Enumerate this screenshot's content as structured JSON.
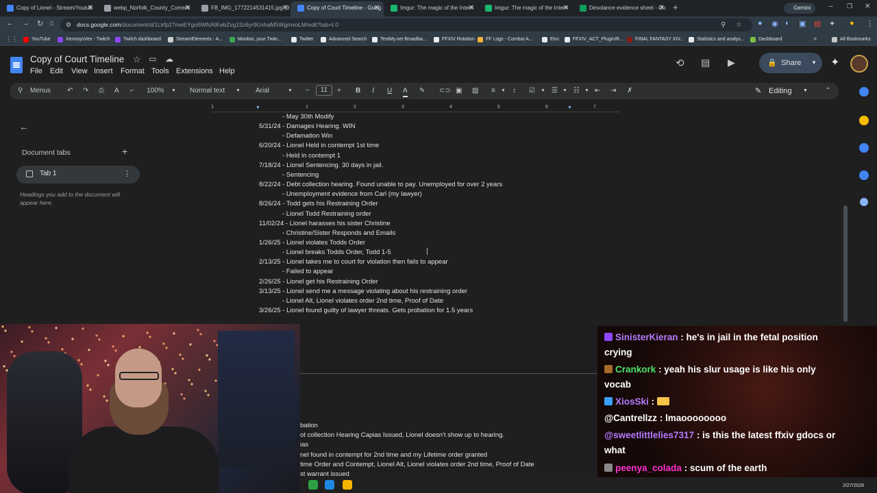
{
  "browser": {
    "tabs": [
      {
        "title": "Copy of Lionel - Stream/Youtub",
        "icon_color": "#4285f4"
      },
      {
        "title": "webp_Norfolk_County_Correcti",
        "icon_color": "#9aa0a6"
      },
      {
        "title": "FB_IMG_1772214531415.jpg (9",
        "icon_color": "#9aa0a6"
      },
      {
        "title": "Copy of Court Timeline - Goog",
        "icon_color": "#4285f4"
      },
      {
        "title": "Imgur: The magic of the Intern",
        "icon_color": "#1bb76e"
      },
      {
        "title": "Imgur: The magic of the Intern",
        "icon_color": "#1bb76e"
      },
      {
        "title": "Desolance evidence sheet - Go",
        "icon_color": "#0f9d58"
      }
    ],
    "new_tab_label": "+",
    "gemini_label": "Gemini",
    "url_host": "docs.google.com",
    "url_path": "/document/d/1Lkfp27meEYgo5WNAtKebZvg15z6yr9UxhaM5WgmvoLM/edit?tab=t.0",
    "bookmarks": [
      {
        "label": "YouTube",
        "icon_color": "#ff0000"
      },
      {
        "label": "XenosysVex - Twitch",
        "icon_color": "#9146ff"
      },
      {
        "label": "Twitch dashboard",
        "icon_color": "#9146ff"
      },
      {
        "label": "StreamElements - A...",
        "icon_color": "#cccccc"
      },
      {
        "label": "Moobot, your Twitc...",
        "icon_color": "#3aa757"
      },
      {
        "label": "Twitter",
        "icon_color": "#e8eaed"
      },
      {
        "label": "Advanced Search",
        "icon_color": "#e8eaed"
      },
      {
        "label": "TestMy.net Broadba...",
        "icon_color": "#e8eaed"
      },
      {
        "label": "FFXIV Rotation",
        "icon_color": "#e8eaed"
      },
      {
        "label": "FF Logs - Combat A...",
        "icon_color": "#f3b23a"
      },
      {
        "label": "Etro",
        "icon_color": "#e8eaed"
      },
      {
        "label": "FFXIV_ACT_Plugin/R...",
        "icon_color": "#e8eaed"
      },
      {
        "label": "FINAL FANTASY XIV...",
        "icon_color": "#8b1a1a"
      },
      {
        "label": "Statistics and analys...",
        "icon_color": "#e8eaed"
      },
      {
        "label": "Dashboard",
        "icon_color": "#7bc043"
      }
    ],
    "all_bookmarks_label": "All Bookmarks"
  },
  "docs": {
    "title": "Copy of Court Timeline",
    "menu": [
      "File",
      "Edit",
      "View",
      "Insert",
      "Format",
      "Tools",
      "Extensions",
      "Help"
    ],
    "share_label": "Share",
    "toolbar": {
      "menus_label": "Menus",
      "zoom": "100%",
      "style": "Normal text",
      "font": "Arial",
      "font_size": "11",
      "editing_label": "Editing"
    },
    "ruler_numbers": [
      "1",
      "1",
      "2",
      "3",
      "4",
      "5",
      "6",
      "7"
    ],
    "sidepanel": {
      "doc_tabs_label": "Document tabs",
      "tab_name": "Tab 1",
      "hint": "Headings you add to the document will appear here."
    },
    "lines": [
      {
        "text": "- May 30th Modify",
        "sub": true
      },
      {
        "text": "5/31/24 - Damages Hearing. WIN",
        "sub": false
      },
      {
        "text": "- Defamation Win",
        "sub": true
      },
      {
        "text": "6/20/24 - Lionel Held in contempt 1st time",
        "sub": false
      },
      {
        "text": "- Held in contempt 1",
        "sub": true
      },
      {
        "text": "7/18/24 - Lionel Sentencing. 30 days in jail.",
        "sub": false
      },
      {
        "text": "- Sentencing",
        "sub": true
      },
      {
        "text": "8/22/24 - Debt collection hearing. Found unable to pay. Unemployed for over 2 years",
        "sub": false
      },
      {
        "text": "- Unemployment evidence from Carl (my lawyer)",
        "sub": true
      },
      {
        "text": "8/26/24 - Todd gets his Restraining Order",
        "sub": false
      },
      {
        "text": "- Lionel Todd Restraining order",
        "sub": true
      },
      {
        "text": "11/02/24 - Lionel harasses his sister Christine",
        "sub": false
      },
      {
        "text": "- Christine/Sister Responds and Emails",
        "sub": true
      },
      {
        "text": "1/26/25 - Lionel violates Todds Order",
        "sub": false
      },
      {
        "text": "- Lionel breaks Todds Order, Todd 1-5",
        "sub": true
      },
      {
        "text": "2/13/25 - Lionel takes me to court for violation then fails to appear",
        "sub": false
      },
      {
        "text": "- Failed to appear",
        "sub": true
      },
      {
        "text": "2/26/25 - Lionel get his Restraining Order",
        "sub": false
      },
      {
        "text": "3/13/25 - Lionel send me a message violating about his restraining order",
        "sub": false
      },
      {
        "text": "- Lionel Alt, Lionel violates order 2nd time, Proof of Date",
        "sub": true
      },
      {
        "text": "3/26/25 - Lionel found guilty of lawyer threats. Gets probation for 1.5 years",
        "sub": false
      }
    ],
    "lower_lines": [
      "bation",
      "ot collection Hearing Capias Issued, Lionel doesn't show up to hearing.",
      "ias",
      "nel found in contempt for 2nd time and my Lifetime order granted",
      "time Order and Contempt, Lionel Alt, Lionel violates order 2nd time, Proof of Date",
      "st warrant issued"
    ]
  },
  "chat": [
    {
      "user": "SinisterKieran",
      "color": "#b57aff",
      "icon_color": "#9146ff",
      "message": "he's in jail in the fetal position crying"
    },
    {
      "user": "Crankork",
      "color": "#4fe36b",
      "icon_color": "#a66b2a",
      "message": "yeah his slur usage is like his only vocab"
    },
    {
      "user": "XiosSki",
      "color": "#b57aff",
      "icon_color": "#3aa0ff",
      "message": ""
    },
    {
      "user": "@Cantrellzz",
      "color": "#ffffff",
      "icon_color": "",
      "message": "lmaoooooooo"
    },
    {
      "user": "@sweetlittlelies7317",
      "color": "#b57aff",
      "icon_color": "",
      "message": "is this the latest ffxiv gdocs or what"
    },
    {
      "user": "peenya_colada",
      "color": "#ff2fd0",
      "icon_color": "#888888",
      "message": "scum of the earth"
    }
  ],
  "taskbar": {
    "date": "2/27/2026"
  }
}
